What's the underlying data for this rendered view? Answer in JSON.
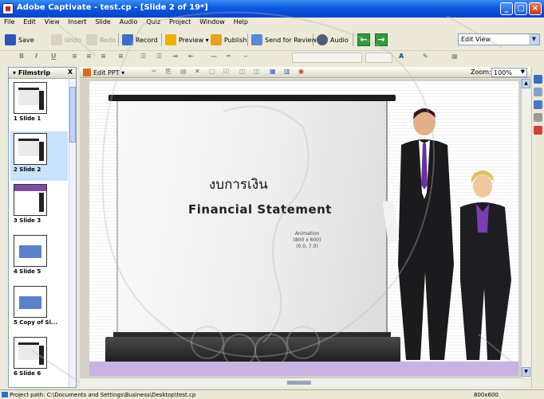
{
  "window": {
    "title": "Adobe Captivate - test.cp - [Slide 2 of 19*]",
    "controls": [
      "minimize-icon",
      "maximize-icon",
      "close-icon"
    ]
  },
  "menubar": [
    "File",
    "Edit",
    "View",
    "Insert",
    "Slide",
    "Audio",
    "Quiz",
    "Project",
    "Window",
    "Help"
  ],
  "toolbar": {
    "save": "Save",
    "undo": "Undo",
    "redo": "Redo",
    "record": "Record",
    "preview": "Preview",
    "publish": "Publish",
    "send_for_review": "Send for Review",
    "audio": "Audio",
    "view_select": "Edit View"
  },
  "format_toolbar": [
    "B",
    "I",
    "U"
  ],
  "filmstrip": {
    "title": "Filmstrip",
    "close": "X",
    "slides": [
      {
        "label": "1 Slide 1",
        "type": "screen"
      },
      {
        "label": "2 Slide 2",
        "type": "screen",
        "selected": true
      },
      {
        "label": "3 Slide 3",
        "type": "band"
      },
      {
        "label": "4 Slide 5",
        "type": "box"
      },
      {
        "label": "5 Copy of Sl...",
        "type": "box"
      },
      {
        "label": "6 Slide 6",
        "type": "screen"
      }
    ]
  },
  "stage": {
    "edit_ppt": "Edit PPT",
    "zoom_label": "Zoom:",
    "zoom_value": "100%"
  },
  "slide": {
    "thai_title": "งบการเงิน",
    "title": "Financial Statement",
    "animation_label": "Animation",
    "animation_size": "(800 x 600)",
    "animation_pos": "(0.0, 7.0)"
  },
  "statusbar": {
    "path": "Project path: C:\\Documents and Settings\\Business\\Desktop\\test.cp",
    "dimensions": "800x600"
  },
  "colors": {
    "titlebar": "#0a5ae0",
    "nav_green": "#2e9d3a",
    "slide_band": "#c9b3e2",
    "suit_tie": "#6b2fa0"
  }
}
